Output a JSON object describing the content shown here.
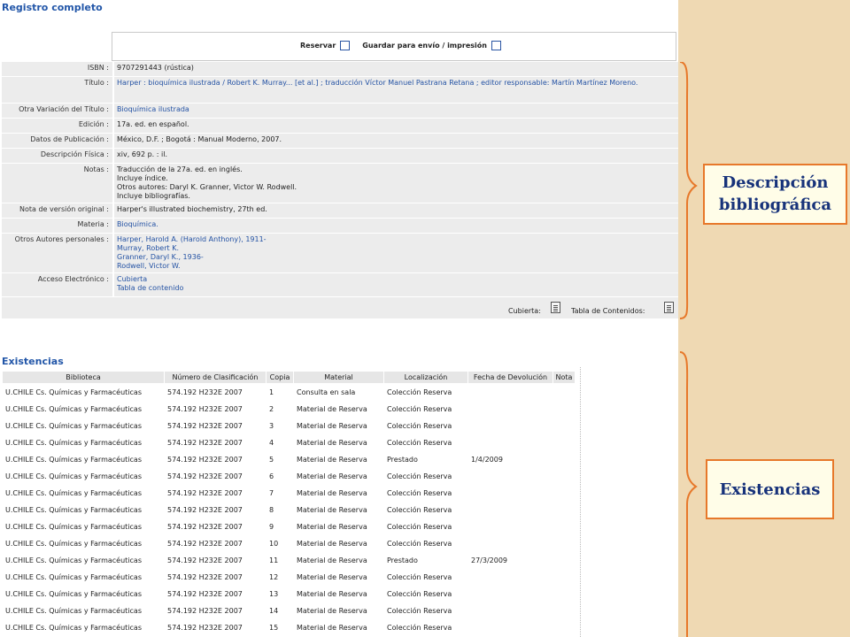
{
  "page": {
    "title": "Registro completo",
    "existencias_title": "Existencias"
  },
  "actions": {
    "reservar": "Reservar",
    "guardar": "Guardar para envío / impresión"
  },
  "record": [
    {
      "label": "ISBN :",
      "value": "9707291443 (rústica)",
      "link": false
    },
    {
      "label": "Título :",
      "value": "Harper : bioquímica ilustrada / Robert K. Murray... [et al.] ; traducción Víctor Manuel Pastrana Retana ; editor responsable: Martín Martínez Moreno.",
      "link": true
    },
    {
      "label": "Otra Variación del Título :",
      "value": "Bioquímica ilustrada",
      "link": true
    },
    {
      "label": "Edición :",
      "value": "17a. ed. en español.",
      "link": false
    },
    {
      "label": "Datos de Publicación :",
      "value": "México, D.F. ; Bogotá : Manual Moderno, 2007.",
      "link": false
    },
    {
      "label": "Descripción Física :",
      "value": "xiv, 692 p. : il.",
      "link": false
    },
    {
      "label": "Notas :",
      "lines": [
        "Traducción de la 27a. ed. en inglés.",
        "Incluye índice.",
        "Otros autores: Daryl K. Granner, Victor W. Rodwell.",
        "Incluye bibliografías."
      ],
      "link": false
    },
    {
      "label": "Nota de versión original :",
      "value": "Harper's illustrated biochemistry, 27th ed.",
      "link": false
    },
    {
      "label": "Materia :",
      "value": "Bioquímica.",
      "link": true
    },
    {
      "label": "Otros Autores personales :",
      "lines": [
        "Harper, Harold A. (Harold Anthony), 1911-",
        "Murray, Robert K.",
        "Granner, Daryl K., 1936-",
        "Rodwell, Victor W."
      ],
      "link": true
    },
    {
      "label": "Acceso Electrónico :",
      "lines": [
        "Cubierta",
        "Tabla de contenido"
      ],
      "link": true
    }
  ],
  "footer": {
    "cubierta": "Cubierta:",
    "tabla": "Tabla de Contenidos:"
  },
  "holdings": {
    "columns": [
      "Biblioteca",
      "Número de Clasificación",
      "Copia",
      "Material",
      "Localización",
      "Fecha de Devolución",
      "Nota"
    ],
    "rows": [
      [
        "U.CHILE Cs. Químicas y Farmacéuticas",
        "574.192 H232E 2007",
        "1",
        "Consulta en sala",
        "Colección Reserva",
        "",
        ""
      ],
      [
        "U.CHILE Cs. Químicas y Farmacéuticas",
        "574.192 H232E 2007",
        "2",
        "Material de Reserva",
        "Colección Reserva",
        "",
        ""
      ],
      [
        "U.CHILE Cs. Químicas y Farmacéuticas",
        "574.192 H232E 2007",
        "3",
        "Material de Reserva",
        "Colección Reserva",
        "",
        ""
      ],
      [
        "U.CHILE Cs. Químicas y Farmacéuticas",
        "574.192 H232E 2007",
        "4",
        "Material de Reserva",
        "Colección Reserva",
        "",
        ""
      ],
      [
        "U.CHILE Cs. Químicas y Farmacéuticas",
        "574.192 H232E 2007",
        "5",
        "Material de Reserva",
        "Prestado",
        "1/4/2009",
        ""
      ],
      [
        "U.CHILE Cs. Químicas y Farmacéuticas",
        "574.192 H232E 2007",
        "6",
        "Material de Reserva",
        "Colección Reserva",
        "",
        ""
      ],
      [
        "U.CHILE Cs. Químicas y Farmacéuticas",
        "574.192 H232E 2007",
        "7",
        "Material de Reserva",
        "Colección Reserva",
        "",
        ""
      ],
      [
        "U.CHILE Cs. Químicas y Farmacéuticas",
        "574.192 H232E 2007",
        "8",
        "Material de Reserva",
        "Colección Reserva",
        "",
        ""
      ],
      [
        "U.CHILE Cs. Químicas y Farmacéuticas",
        "574.192 H232E 2007",
        "9",
        "Material de Reserva",
        "Colección Reserva",
        "",
        ""
      ],
      [
        "U.CHILE Cs. Químicas y Farmacéuticas",
        "574.192 H232E 2007",
        "10",
        "Material de Reserva",
        "Colección Reserva",
        "",
        ""
      ],
      [
        "U.CHILE Cs. Químicas y Farmacéuticas",
        "574.192 H232E 2007",
        "11",
        "Material de Reserva",
        "Prestado",
        "27/3/2009",
        ""
      ],
      [
        "U.CHILE Cs. Químicas y Farmacéuticas",
        "574.192 H232E 2007",
        "12",
        "Material de Reserva",
        "Colección Reserva",
        "",
        ""
      ],
      [
        "U.CHILE Cs. Químicas y Farmacéuticas",
        "574.192 H232E 2007",
        "13",
        "Material de Reserva",
        "Colección Reserva",
        "",
        ""
      ],
      [
        "U.CHILE Cs. Químicas y Farmacéuticas",
        "574.192 H232E 2007",
        "14",
        "Material de Reserva",
        "Colección Reserva",
        "",
        ""
      ],
      [
        "U.CHILE Cs. Químicas y Farmacéuticas",
        "574.192 H232E 2007",
        "15",
        "Material de Reserva",
        "Colección Reserva",
        "",
        ""
      ]
    ]
  },
  "annotations": {
    "desc_line1": "Descripción",
    "desc_line2": "bibliográfica",
    "existencias": "Existencias"
  },
  "colors": {
    "link": "#2553a4",
    "annotation_border": "#e7782a",
    "annotation_text": "#17327a",
    "side_background": "#efd9b3"
  },
  "icons": [
    "checkbox-reservar",
    "checkbox-guardar",
    "document-icon-cubierta",
    "document-icon-tabla"
  ]
}
